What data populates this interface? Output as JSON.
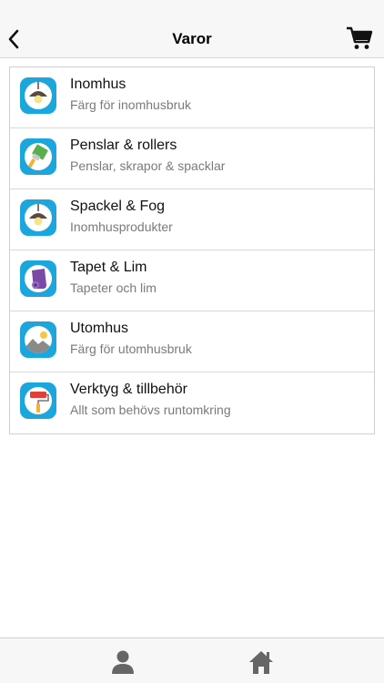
{
  "header": {
    "title": "Varor",
    "back_icon": "chevron-left-icon",
    "cart_icon": "shopping-cart-icon"
  },
  "categories": [
    {
      "title": "Inomhus",
      "subtitle": "Färg för inomhusbruk",
      "icon": "ceiling-lamp-icon"
    },
    {
      "title": "Penslar & rollers",
      "subtitle": "Penslar, skrapor & spacklar",
      "icon": "paint-brush-icon"
    },
    {
      "title": "Spackel & Fog",
      "subtitle": "Inomhusprodukter",
      "icon": "ceiling-lamp-icon"
    },
    {
      "title": "Tapet & Lim",
      "subtitle": "Tapeter och lim",
      "icon": "wallpaper-roll-icon"
    },
    {
      "title": "Utomhus",
      "subtitle": "Färg för utomhusbruk",
      "icon": "landscape-icon"
    },
    {
      "title": "Verktyg & tillbehör",
      "subtitle": "Allt som behövs runtomkring",
      "icon": "paint-roller-icon"
    }
  ],
  "tabbar": {
    "items": [
      {
        "icon": "user-icon"
      },
      {
        "icon": "home-icon"
      }
    ]
  },
  "colors": {
    "icon_background": "#1ba6dd",
    "lamp_shade": "#5a4a3f",
    "bulb": "#f6e38a",
    "wallpaper": "#7b4aa5",
    "roller_head": "#e0403a",
    "roller_handle": "#f2b233"
  }
}
